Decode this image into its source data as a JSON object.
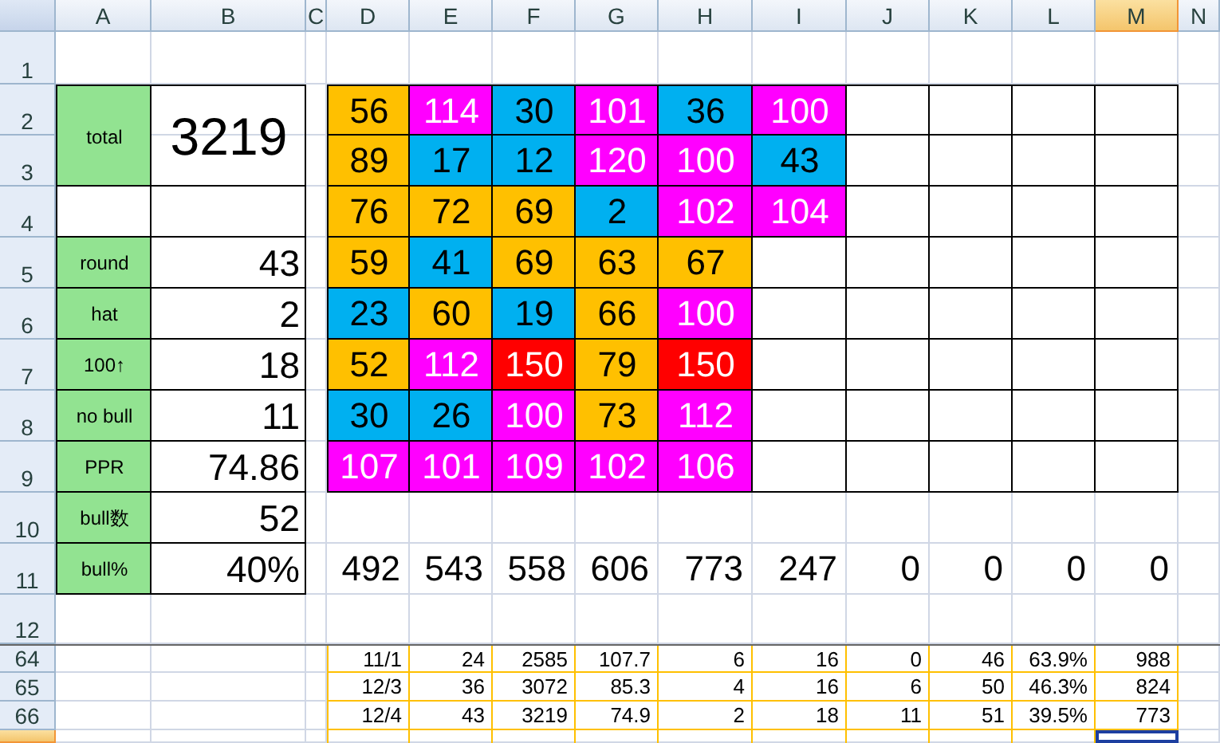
{
  "columns": [
    {
      "label": "A",
      "selected": false
    },
    {
      "label": "B",
      "selected": false
    },
    {
      "label": "C",
      "selected": false
    },
    {
      "label": "D",
      "selected": false
    },
    {
      "label": "E",
      "selected": false
    },
    {
      "label": "F",
      "selected": false
    },
    {
      "label": "G",
      "selected": false
    },
    {
      "label": "H",
      "selected": false
    },
    {
      "label": "I",
      "selected": false
    },
    {
      "label": "J",
      "selected": false
    },
    {
      "label": "K",
      "selected": false
    },
    {
      "label": "L",
      "selected": false
    },
    {
      "label": "M",
      "selected": true
    },
    {
      "label": "N",
      "selected": false
    }
  ],
  "rows": [
    {
      "label": "1",
      "selected": false
    },
    {
      "label": "2",
      "selected": false
    },
    {
      "label": "3",
      "selected": false
    },
    {
      "label": "4",
      "selected": false
    },
    {
      "label": "5",
      "selected": false
    },
    {
      "label": "6",
      "selected": false
    },
    {
      "label": "7",
      "selected": false
    },
    {
      "label": "8",
      "selected": false
    },
    {
      "label": "9",
      "selected": false
    },
    {
      "label": "10",
      "selected": false
    },
    {
      "label": "11",
      "selected": false
    },
    {
      "label": "12",
      "selected": false
    },
    {
      "label": "64",
      "selected": false
    },
    {
      "label": "65",
      "selected": false
    },
    {
      "label": "66",
      "selected": false
    },
    {
      "selected": true
    }
  ],
  "summary": [
    {
      "label": "total",
      "value": "3219",
      "kind": "total"
    },
    {
      "label": "round",
      "value": "43",
      "kind": "stat"
    },
    {
      "label": "hat",
      "value": "2",
      "kind": "stat"
    },
    {
      "label": "100↑",
      "value": "18",
      "kind": "stat"
    },
    {
      "label": "no bull",
      "value": "11",
      "kind": "stat"
    },
    {
      "label": "PPR",
      "value": "74.86",
      "kind": "stat"
    },
    {
      "label": "bull数",
      "value": "52",
      "kind": "stat"
    },
    {
      "label": "bull%",
      "value": "40%",
      "kind": "stat"
    }
  ],
  "board": [
    [
      {
        "value": "56",
        "color": "#ffc000"
      },
      {
        "value": "114",
        "color": "#ff00ff"
      },
      {
        "value": "30",
        "color": "#00b0f0"
      },
      {
        "value": "101",
        "color": "#ff00ff"
      },
      {
        "value": "36",
        "color": "#00b0f0"
      },
      {
        "value": "100",
        "color": "#ff00ff"
      }
    ],
    [
      {
        "value": "89",
        "color": "#ffc000"
      },
      {
        "value": "17",
        "color": "#00b0f0"
      },
      {
        "value": "12",
        "color": "#00b0f0"
      },
      {
        "value": "120",
        "color": "#ff00ff"
      },
      {
        "value": "100",
        "color": "#ff00ff"
      },
      {
        "value": "43",
        "color": "#00b0f0"
      }
    ],
    [
      {
        "value": "76",
        "color": "#ffc000"
      },
      {
        "value": "72",
        "color": "#ffc000"
      },
      {
        "value": "69",
        "color": "#ffc000"
      },
      {
        "value": "2",
        "color": "#00b0f0"
      },
      {
        "value": "102",
        "color": "#ff00ff"
      },
      {
        "value": "104",
        "color": "#ff00ff"
      }
    ],
    [
      {
        "value": "59",
        "color": "#ffc000"
      },
      {
        "value": "41",
        "color": "#00b0f0"
      },
      {
        "value": "69",
        "color": "#ffc000"
      },
      {
        "value": "63",
        "color": "#ffc000"
      },
      {
        "value": "67",
        "color": "#ffc000"
      }
    ],
    [
      {
        "value": "23",
        "color": "#00b0f0"
      },
      {
        "value": "60",
        "color": "#ffc000"
      },
      {
        "value": "19",
        "color": "#00b0f0"
      },
      {
        "value": "66",
        "color": "#ffc000"
      },
      {
        "value": "100",
        "color": "#ff00ff"
      }
    ],
    [
      {
        "value": "52",
        "color": "#ffc000"
      },
      {
        "value": "112",
        "color": "#ff00ff"
      },
      {
        "value": "150",
        "color": "#ff0000"
      },
      {
        "value": "79",
        "color": "#ffc000"
      },
      {
        "value": "150",
        "color": "#ff0000"
      }
    ],
    [
      {
        "value": "30",
        "color": "#00b0f0"
      },
      {
        "value": "26",
        "color": "#00b0f0"
      },
      {
        "value": "100",
        "color": "#ff00ff"
      },
      {
        "value": "73",
        "color": "#ffc000"
      },
      {
        "value": "112",
        "color": "#ff00ff"
      }
    ],
    [
      {
        "value": "107",
        "color": "#ff00ff"
      },
      {
        "value": "101",
        "color": "#ff00ff"
      },
      {
        "value": "109",
        "color": "#ff00ff"
      },
      {
        "value": "102",
        "color": "#ff00ff"
      },
      {
        "value": "106",
        "color": "#ff00ff"
      }
    ]
  ],
  "totals": [
    "492",
    "543",
    "558",
    "606",
    "773",
    "247",
    "0",
    "0",
    "0",
    "0"
  ],
  "log": [
    [
      "11/1",
      "24",
      "2585",
      "107.7",
      "6",
      "16",
      "0",
      "46",
      "63.9%",
      "988"
    ],
    [
      "12/3",
      "36",
      "3072",
      "85.3",
      "4",
      "16",
      "6",
      "50",
      "46.3%",
      "824"
    ],
    [
      "12/4",
      "43",
      "3219",
      "74.9",
      "2",
      "18",
      "11",
      "51",
      "39.5%",
      "773"
    ]
  ]
}
